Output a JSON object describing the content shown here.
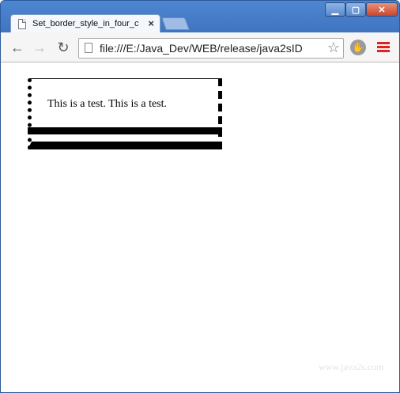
{
  "tab": {
    "title": "Set_border_style_in_four_c",
    "close_glyph": "×",
    "icon": "document-icon"
  },
  "window_controls": {
    "minimize_glyph": "▁",
    "maximize_glyph": "▢",
    "close_glyph": "✕"
  },
  "toolbar": {
    "back_glyph": "←",
    "forward_glyph": "→",
    "reload_glyph": "↻",
    "url": "file:///E:/Java_Dev/WEB/release/java2sID",
    "star_glyph": "☆",
    "extension_icon": "adblock-hand-icon",
    "menu_icon": "hamburger-menu-icon",
    "menu_color": "#dd2222"
  },
  "page": {
    "demo_text": "This is a test. This is a test.",
    "watermark": "www.java2s.com"
  }
}
